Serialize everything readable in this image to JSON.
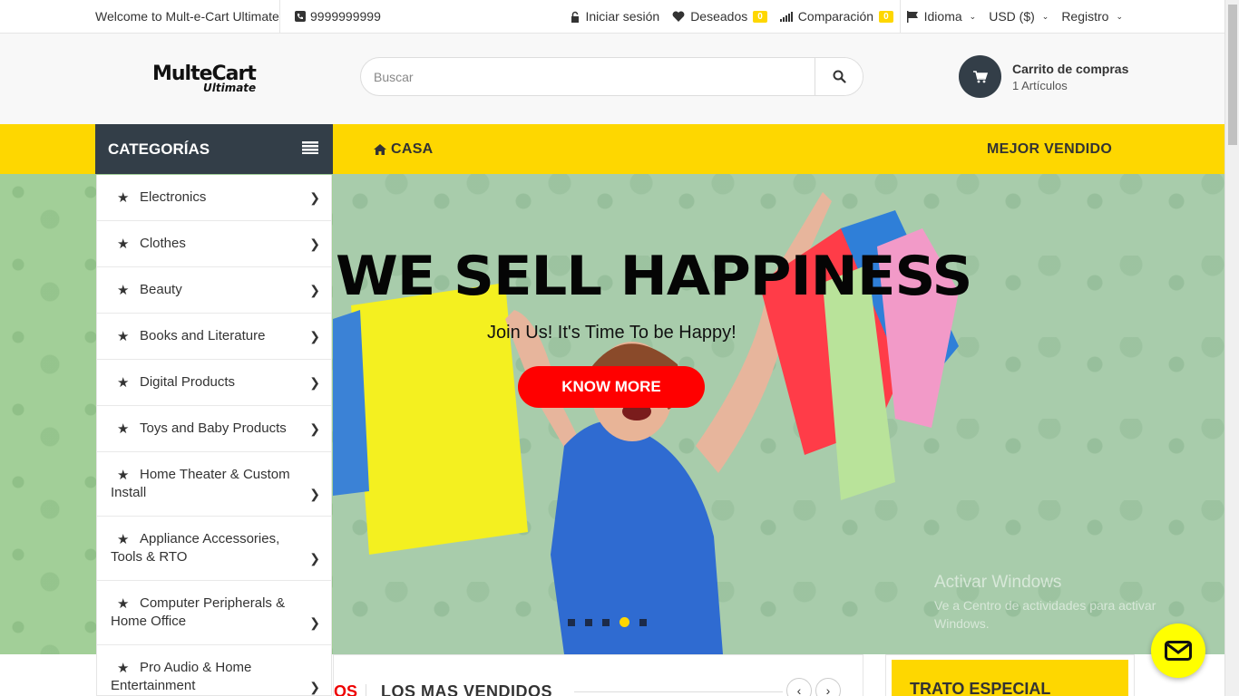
{
  "topbar": {
    "welcome": "Welcome to Mult-e-Cart Ultimate",
    "phone": "9999999999",
    "login": "Iniciar sesión",
    "wishlist": "Deseados",
    "wishlist_count": "0",
    "compare": "Comparación",
    "compare_count": "0",
    "language": "Idioma",
    "currency": "USD ($)",
    "register": "Registro"
  },
  "header": {
    "logo_line1": "MulteCart",
    "logo_line2": "Ultimate",
    "search_placeholder": "Buscar",
    "cart_title": "Carrito de compras",
    "cart_items": "1 Artículos"
  },
  "nav": {
    "categories_label": "CATEGORÍAS",
    "home": "CASA",
    "best_seller": "MEJOR VENDIDO"
  },
  "categories": [
    "Electronics",
    "Clothes",
    "Beauty",
    "Books and Literature",
    "Digital Products",
    "Toys and Baby Products",
    "Home Theater & Custom Install",
    "Appliance Accessories, Tools & RTO",
    "Computer Peripherals & Home Office",
    "Pro Audio & Home Entertainment"
  ],
  "hero": {
    "headline": "WE SELL HAPPINESS",
    "subtitle": "Join Us! It's Time To be Happy!",
    "button": "KNOW MORE",
    "slide_count": 5,
    "active_slide": 4
  },
  "windows_watermark": {
    "title": "Activar Windows",
    "text": "Ve a Centro de actividades para activar Windows."
  },
  "sections": {
    "tab_partial": "OS",
    "best_sellers": "LOS MAS VENDIDOS",
    "special_deal": "TRATO ESPECIAL"
  },
  "colors": {
    "accent_yellow": "#fed700",
    "dark": "#333e48",
    "cta_red": "#ff0000"
  }
}
